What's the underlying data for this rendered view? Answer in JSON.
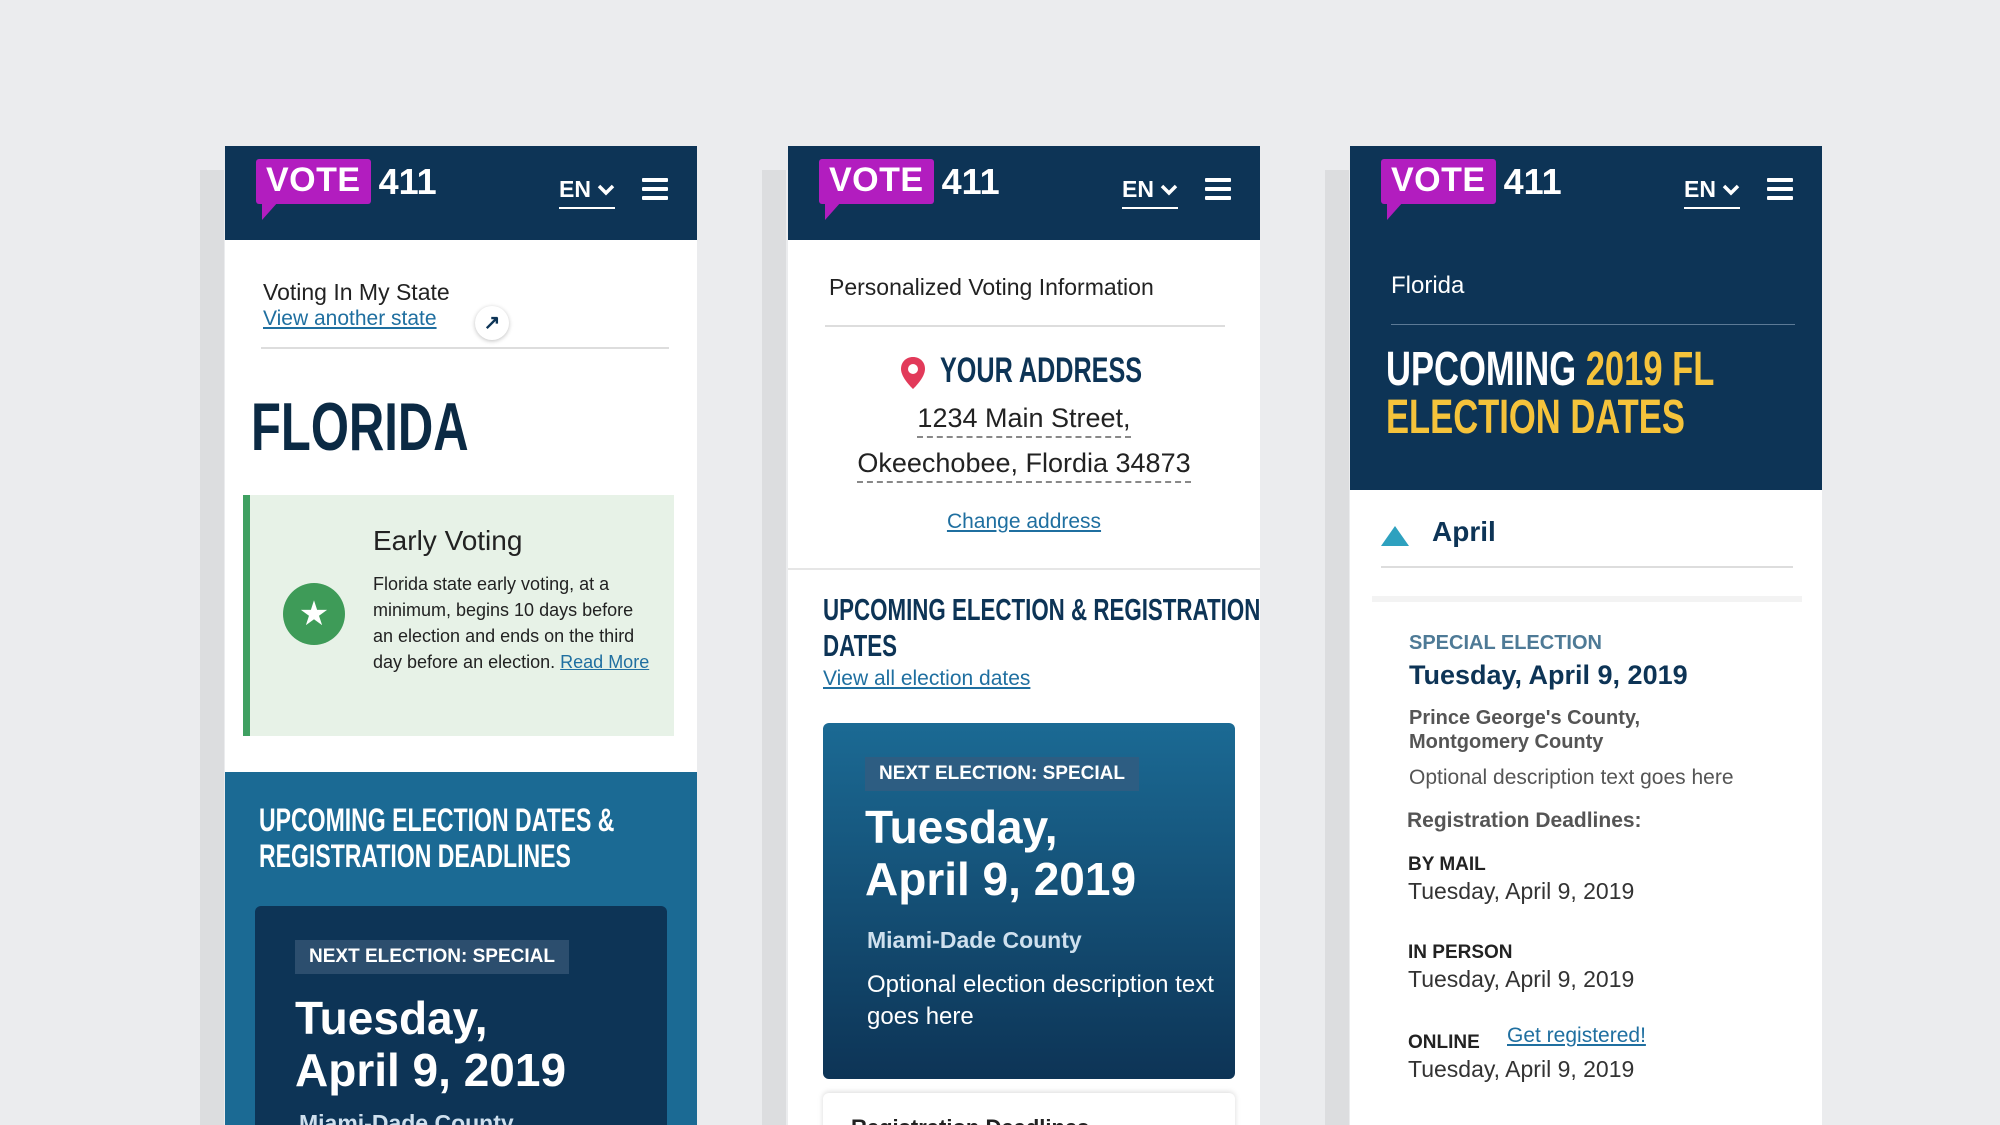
{
  "brand": {
    "vote": "VOTE",
    "num": "411"
  },
  "lang": "EN",
  "screen1": {
    "state_heading": "Voting In My State",
    "view_another": "View another state",
    "state_name": "FLORIDA",
    "early_title": "Early Voting",
    "early_text": "Florida state early voting, at a minimum, begins 10 days before an election and ends on the third day before an election.",
    "read_more": "Read More",
    "upcoming_line1": "UPCOMING ELECTION DATES &",
    "upcoming_line2": "REGISTRATION DEADLINES",
    "next_tag": "NEXT ELECTION: SPECIAL",
    "date_line1": "Tuesday,",
    "date_line2": "April 9, 2019",
    "county": "Miami-Dade County"
  },
  "screen2": {
    "personalized": "Personalized Voting Information",
    "your_address": "YOUR ADDRESS",
    "address_line1": "1234 Main Street,",
    "address_line2": "Okeechobee, Flordia 34873",
    "change_address": "Change address",
    "upcoming_line1": "UPCOMING ELECTION & REGISTRATION",
    "upcoming_line2": "DATES",
    "view_all": "View all election dates",
    "next_tag": "NEXT ELECTION: SPECIAL",
    "date_line1": "Tuesday,",
    "date_line2": "April 9, 2019",
    "county": "Miami-Dade County",
    "description": "Optional election description text goes here",
    "reg_deadlines_partial": "Registration Deadlines"
  },
  "screen3": {
    "state": "Florida",
    "upcoming_white1": "UPCOMING ",
    "upcoming_yellow1": "2019 FL",
    "upcoming_yellow2": "ELECTION DATES",
    "month": "April",
    "special": "SPECIAL ELECTION",
    "date": "Tuesday, April 9, 2019",
    "counties": "Prince George's County, Montgomery County",
    "optional_desc": "Optional description text goes here",
    "reg_deadlines": "Registration Deadlines:",
    "by_mail_label": "BY MAIL",
    "by_mail_date": "Tuesday, April 9, 2019",
    "in_person_label": "IN PERSON",
    "in_person_date": "Tuesday, April 9, 2019",
    "online_label": "ONLINE",
    "get_registered": "Get registered!",
    "online_date": "Tuesday, April 9, 2019"
  },
  "colors": {
    "navy": "#0d3456",
    "purple": "#b21dbf",
    "teal_blue": "#1b6a94",
    "green": "#3e9b58",
    "yellow": "#f5c33b"
  }
}
